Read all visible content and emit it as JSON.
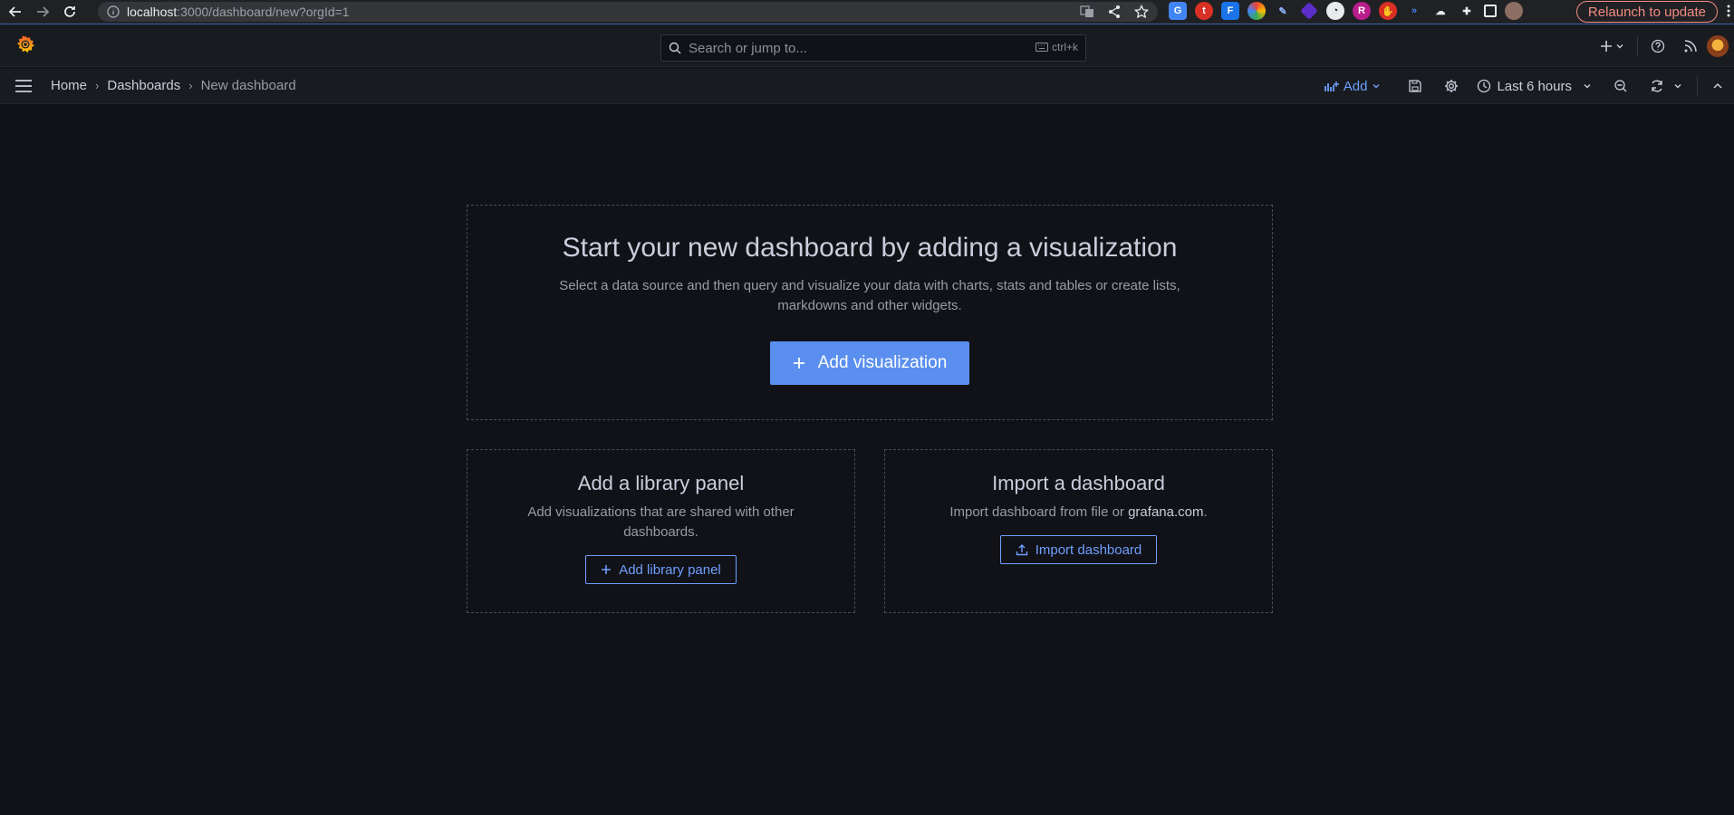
{
  "browser": {
    "url_host": "localhost",
    "url_rest": ":3000/dashboard/new?orgId=1",
    "relaunch_label": "Relaunch to update"
  },
  "search": {
    "placeholder": "Search or jump to...",
    "shortcut": "ctrl+k"
  },
  "breadcrumb": {
    "home": "Home",
    "dashboards": "Dashboards",
    "current": "New dashboard"
  },
  "toolbar": {
    "add_label": "Add",
    "time_range": "Last 6 hours"
  },
  "hero": {
    "title": "Start your new dashboard by adding a visualization",
    "description": "Select a data source and then query and visualize your data with charts, stats and tables or create lists, markdowns and other widgets.",
    "button": "Add visualization"
  },
  "library_card": {
    "title": "Add a library panel",
    "description": "Add visualizations that are shared with other dashboards.",
    "button": "Add library panel"
  },
  "import_card": {
    "title": "Import a dashboard",
    "description_prefix": "Import dashboard from file or ",
    "link": "grafana.com",
    "description_suffix": ".",
    "button": "Import dashboard"
  },
  "colors": {
    "background": "#111217",
    "primary": "#5a8ff0",
    "link": "#6e9fff",
    "grafana_orange": "#f46800"
  }
}
